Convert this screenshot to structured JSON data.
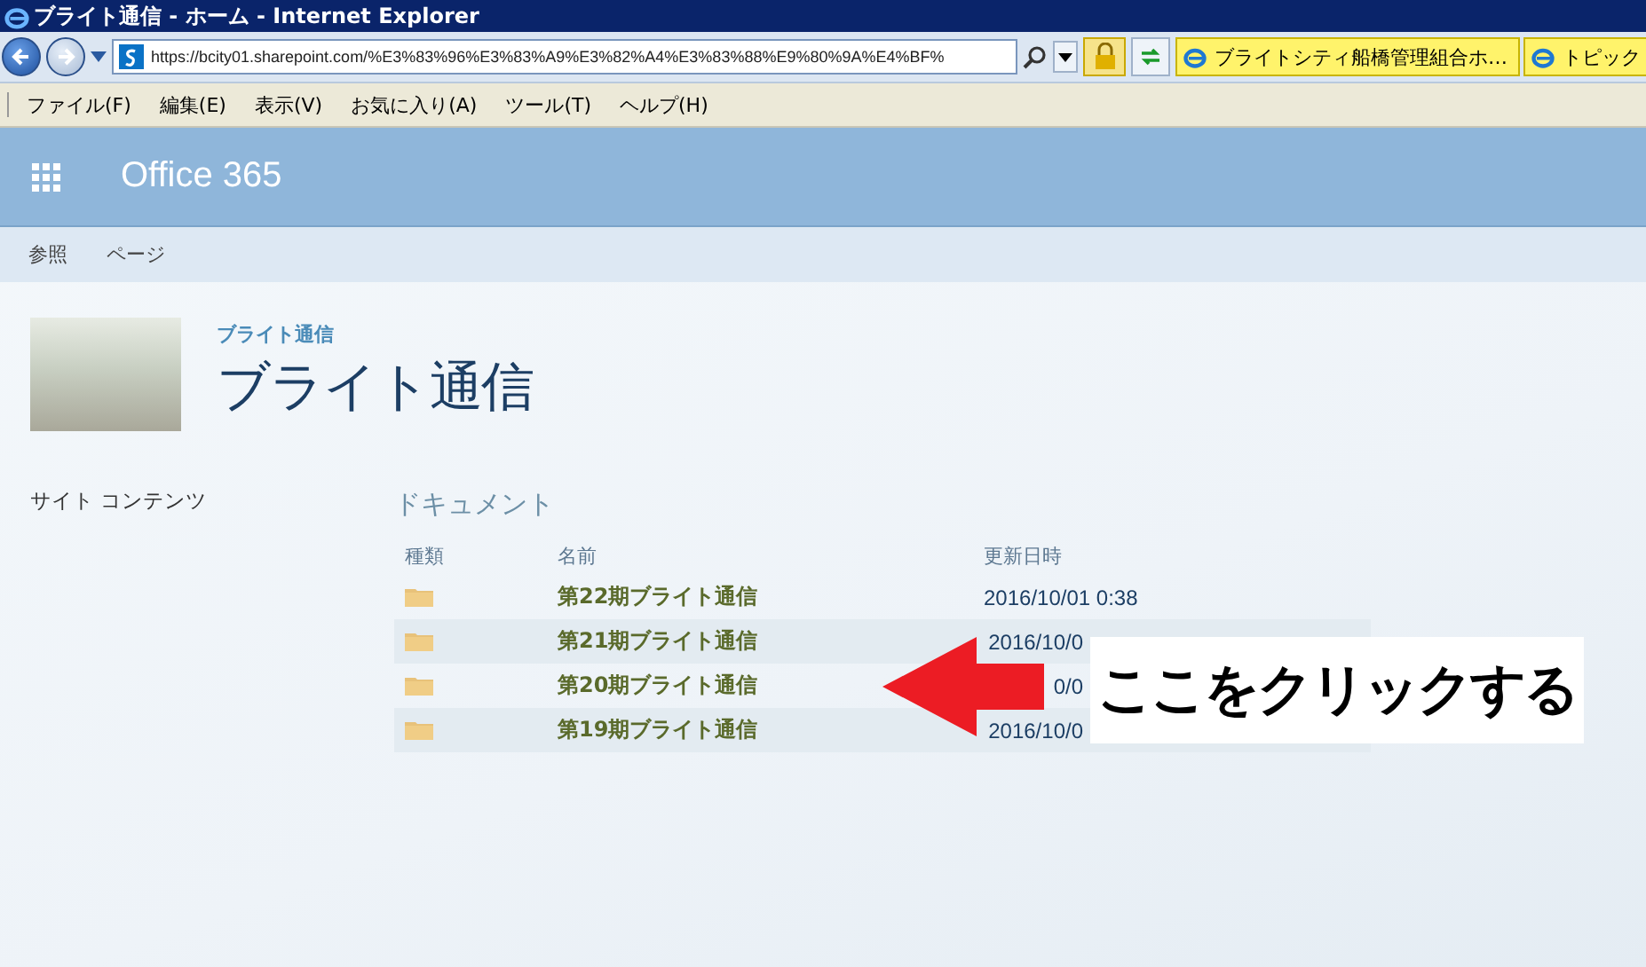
{
  "window": {
    "title": "ブライト通信 - ホーム - Internet Explorer"
  },
  "address_bar": {
    "url": "https://bcity01.sharepoint.com/%E3%83%96%E3%83%A9%E3%82%A4%E3%83%88%E9%80%9A%E4%BF%"
  },
  "browser_tabs": [
    {
      "label": "ブライトシティ船橋管理組合ホ…"
    },
    {
      "label": "トピック"
    }
  ],
  "menu": [
    "ファイル(F)",
    "編集(E)",
    "表示(V)",
    "お気に入り(A)",
    "ツール(T)",
    "ヘルプ(H)"
  ],
  "suite_bar": {
    "title": "Office 365"
  },
  "ribbon_tabs": [
    "参照",
    "ページ"
  ],
  "site": {
    "breadcrumb": "ブライト通信",
    "title": "ブライト通信"
  },
  "quick_launch": [
    "サイト コンテンツ"
  ],
  "library": {
    "title": "ドキュメント",
    "columns": [
      "種類",
      "名前",
      "更新日時"
    ],
    "rows": [
      {
        "name": "第22期ブライト通信",
        "modified": "2016/10/01 0:38"
      },
      {
        "name": "第21期ブライト通信",
        "modified": "2016/10/0"
      },
      {
        "name": "第20期ブライト通信",
        "modified": "0/0"
      },
      {
        "name": "第19期ブライト通信",
        "modified": "2016/10/0"
      }
    ]
  },
  "callout": {
    "text": "ここをクリックする"
  }
}
